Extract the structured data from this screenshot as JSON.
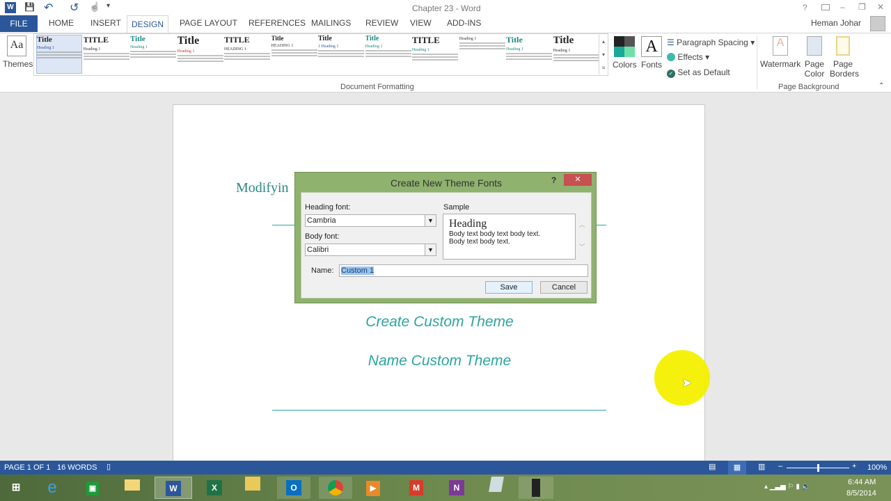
{
  "window": {
    "title": "Chapter 23 - Word",
    "help": "?",
    "minimize": "–",
    "restore": "❐",
    "close": "✕",
    "user": "Heman Johar"
  },
  "qat": {
    "word_icon": "W",
    "save": "💾",
    "undo": "↶",
    "redo": "↺",
    "touch": "☝",
    "customize": "▾"
  },
  "tabs": [
    "FILE",
    "HOME",
    "INSERT",
    "DESIGN",
    "PAGE LAYOUT",
    "REFERENCES",
    "MAILINGS",
    "REVIEW",
    "VIEW",
    "ADD-INS"
  ],
  "ribbon": {
    "themes_label": "Themes",
    "gallery": [
      {
        "title": "Title",
        "heading": "Heading 1"
      },
      {
        "title": "TITLE",
        "heading": "Heading 1"
      },
      {
        "title": "Title",
        "heading": "Heading 1"
      },
      {
        "title": "Title",
        "heading": "Heading 1"
      },
      {
        "title": "TITLE",
        "heading": "HEADING 1"
      },
      {
        "title": "Title",
        "heading": "HEADING 1"
      },
      {
        "title": "Title",
        "heading": "1 Heading 1"
      },
      {
        "title": "Title",
        "heading": "Heading 1"
      },
      {
        "title": "TITLE",
        "heading": "Heading 1"
      },
      {
        "title": "",
        "heading": "Heading 1"
      },
      {
        "title": "Title",
        "heading": "Heading 1"
      },
      {
        "title": "Title",
        "heading": "Heading 1"
      }
    ],
    "colors_label": "Colors",
    "fonts_label": "Fonts",
    "fonts_glyph": "A",
    "paragraph_spacing": "Paragraph Spacing",
    "effects": "Effects",
    "set_default": "Set as Default",
    "doc_formatting_group": "Document Formatting",
    "watermark": "Watermark",
    "page_color_1": "Page",
    "page_color_2": "Color",
    "page_borders_1": "Page",
    "page_borders_2": "Borders",
    "page_background_group": "Page Background"
  },
  "document": {
    "heading_partial": "Modifyin",
    "line1": "Create Custom Theme",
    "line2": "Name Custom Theme"
  },
  "dialog": {
    "title": "Create New Theme Fonts",
    "help": "?",
    "close": "✕",
    "heading_font_label": "Heading font:",
    "heading_font_value": "Cambria",
    "body_font_label": "Body font:",
    "body_font_value": "Calibri",
    "sample_label": "Sample",
    "sample_heading": "Heading",
    "sample_body1": "Body text body text body text.",
    "sample_body2": "Body text body text.",
    "name_label": "Name:",
    "name_value": "Custom 1",
    "save": "Save",
    "cancel": "Cancel"
  },
  "status": {
    "page": "PAGE 1 OF 1",
    "words": "16 WORDS",
    "zoom": "100%",
    "zoom_percent": 100
  },
  "taskbar": {
    "apps": [
      "Start",
      "Internet Explorer",
      "Store",
      "Explorer",
      "Word",
      "Excel",
      "File Manager",
      "Outlook",
      "Chrome",
      "Media",
      "Office",
      "OneNote",
      "Notes",
      "Camera"
    ],
    "time": "6:44 AM",
    "date": "8/5/2014"
  },
  "colors": {
    "accent": "#2b579a",
    "teal": "#2aa5a0",
    "dialog_frame": "#8fb26f",
    "close_red": "#c75050"
  }
}
